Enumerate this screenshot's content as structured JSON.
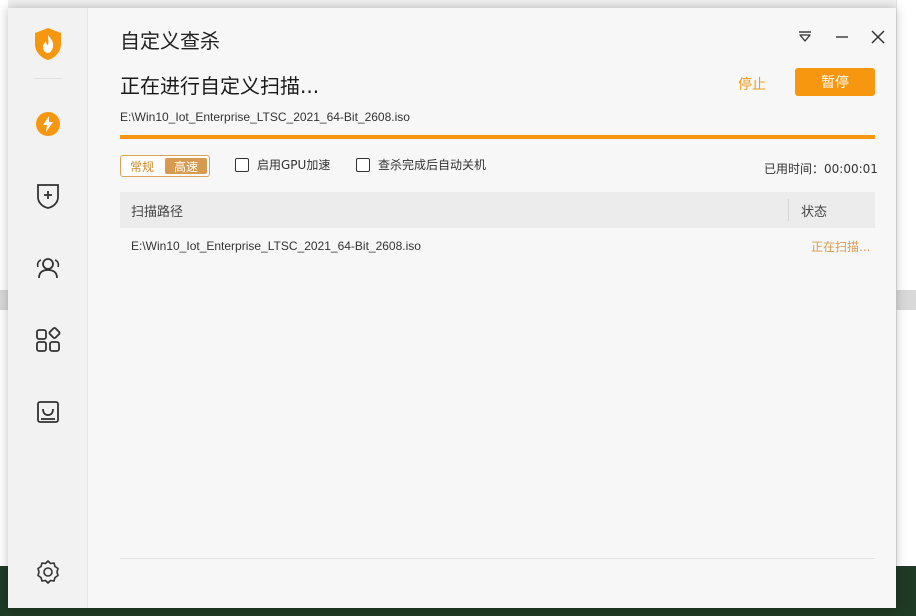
{
  "app": {
    "title": "自定义查杀"
  },
  "sidebar": {
    "items": [
      {
        "icon": "shield-flame-logo-icon"
      },
      {
        "icon": "lightning-icon"
      },
      {
        "icon": "shield-plus-icon"
      },
      {
        "icon": "users-icon"
      },
      {
        "icon": "apps-grid-icon"
      },
      {
        "icon": "box-tray-icon"
      },
      {
        "icon": "gear-icon"
      }
    ]
  },
  "window_controls": {
    "menu_icon": "menu-triangle-icon",
    "minimize_icon": "minimize-icon",
    "close_icon": "close-icon"
  },
  "scan": {
    "heading": "正在进行自定义扫描...",
    "stop_label": "停止",
    "pause_label": "暂停",
    "file": "E:\\Win10_Iot_Enterprise_LTSC_2021_64-Bit_2608.iso",
    "progress": 1.0,
    "mode_normal": "常规",
    "mode_fast": "高速",
    "gpu_label": "启用GPU加速",
    "shutdown_label": "查杀完成后自动关机",
    "elapsed": "已用时间：00:00:01"
  },
  "table": {
    "col_path": "扫描路径",
    "col_status": "状态",
    "rows": [
      {
        "path": "E:\\Win10_Iot_Enterprise_LTSC_2021_64-Bit_2608.iso",
        "status": "正在扫描..."
      }
    ]
  },
  "colors": {
    "accent": "#f7970f",
    "status_text": "#d99a4e"
  }
}
